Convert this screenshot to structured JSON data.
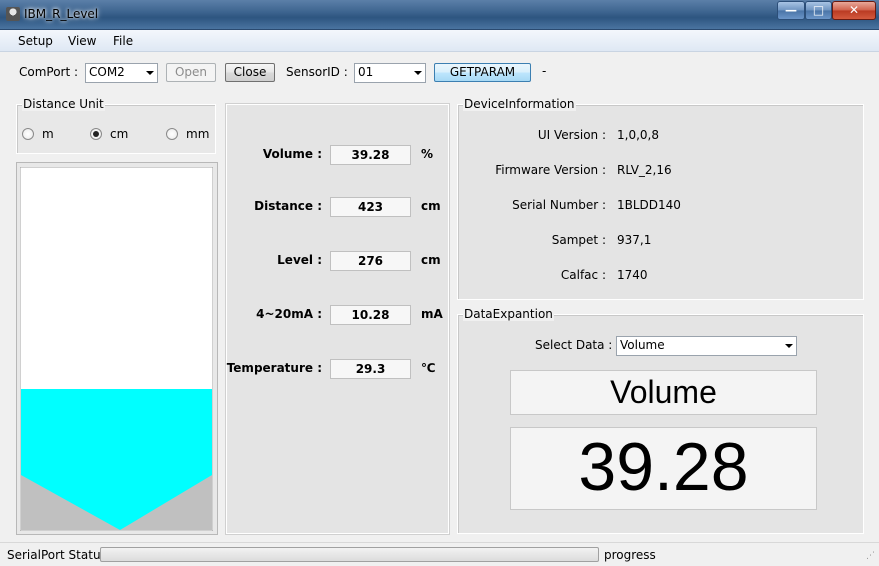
{
  "window": {
    "title": "IBM_R_Level",
    "min": "—",
    "max": "□",
    "close": "✕"
  },
  "menu": {
    "setup": "Setup",
    "view": "View",
    "file": "File"
  },
  "toolbar": {
    "comport_label": "ComPort :",
    "comport_value": "COM2",
    "open_label": "Open",
    "close_label": "Close",
    "sensor_label": "SensorID :",
    "sensor_value": "01",
    "getparam_label": "GETPARAM",
    "status_dash": "-"
  },
  "distance_unit": {
    "title": "Distance Unit",
    "options": [
      {
        "label": "m",
        "checked": false
      },
      {
        "label": "cm",
        "checked": true
      },
      {
        "label": "mm",
        "checked": false
      }
    ]
  },
  "tank": {
    "fill_fraction": 0.39,
    "liquid_color": "#00ffff",
    "bottom_color": "#c0c0c0"
  },
  "measurements": [
    {
      "label": "Volume :",
      "value": "39.28",
      "unit": "%"
    },
    {
      "label": "Distance :",
      "value": "423",
      "unit": "cm"
    },
    {
      "label": "Level :",
      "value": "276",
      "unit": "cm"
    },
    {
      "label": "4~20mA :",
      "value": "10.28",
      "unit": "mA"
    },
    {
      "label": "Temperature :",
      "value": "29.3",
      "unit": "℃"
    }
  ],
  "device_info": {
    "title": "DeviceInformation",
    "rows": [
      {
        "label": "UI Version :",
        "value": "1,0,0,8"
      },
      {
        "label": "Firmware Version :",
        "value": "RLV_2,16"
      },
      {
        "label": "Serial Number :",
        "value": "1BLDD140"
      },
      {
        "label": "Sampet :",
        "value": "937,1"
      },
      {
        "label": "Calfac :",
        "value": "1740"
      }
    ]
  },
  "data_expansion": {
    "title": "DataExpantion",
    "select_label": "Select Data :",
    "select_value": "Volume",
    "display_name": "Volume",
    "display_value": "39.28"
  },
  "statusbar": {
    "label": "SerialPort Status",
    "progress_text": "progress",
    "progress_value": 0
  }
}
